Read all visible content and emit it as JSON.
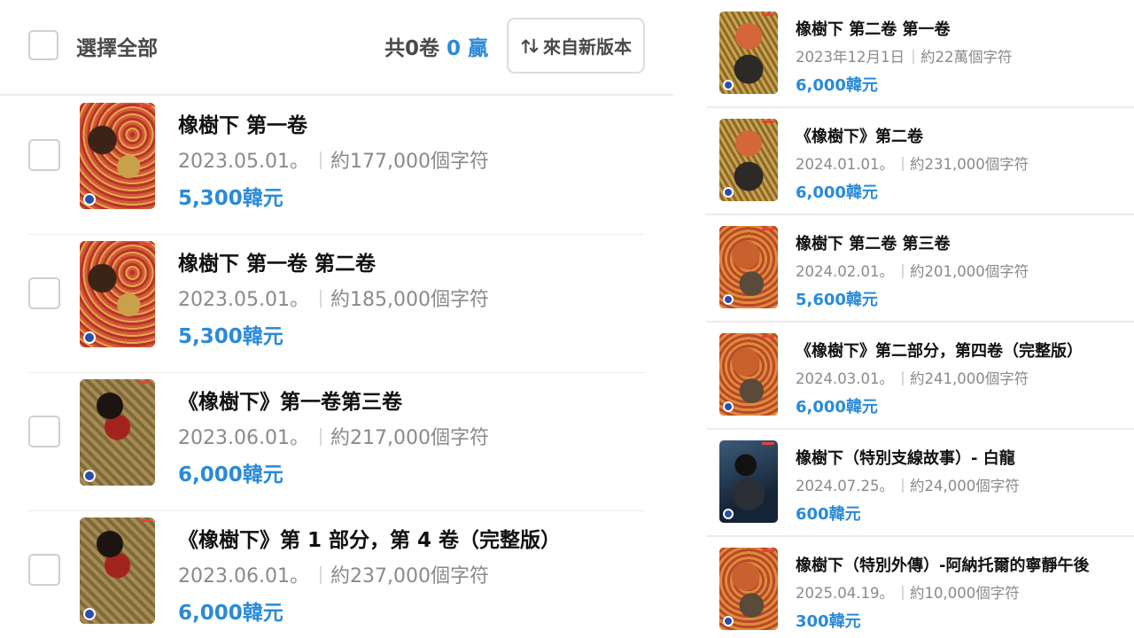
{
  "header": {
    "select_all_label": "選擇全部",
    "count_prefix": "共0卷",
    "count_num": "0",
    "count_suffix": "贏",
    "sort_label": "來自新版本",
    "sort_icon": "sort-arrows-icon"
  },
  "left_items": [
    {
      "title": "橡樹下 第一卷",
      "date": "2023.05.01。",
      "chars": "約177,000個字符",
      "price": "5,300韓元",
      "cover": "cv-a"
    },
    {
      "title": "橡樹下 第一卷 第二卷",
      "date": "2023.05.01。",
      "chars": "約185,000個字符",
      "price": "5,300韓元",
      "cover": "cv-a"
    },
    {
      "title": "《橡樹下》第一卷第三卷",
      "date": "2023.06.01。",
      "chars": "約217,000個字符",
      "price": "6,000韓元",
      "cover": "cv-b"
    },
    {
      "title": "《橡樹下》第 1 部分，第 4 卷（完整版）",
      "date": "2023.06.01。",
      "chars": "約237,000個字符",
      "price": "6,000韓元",
      "cover": "cv-b"
    }
  ],
  "right_items": [
    {
      "title": "橡樹下 第二卷 第一卷",
      "date": "2023年12月1日",
      "chars": "約22萬個字符",
      "price": "6,000韓元",
      "cover": "cv-c"
    },
    {
      "title": "《橡樹下》第二卷",
      "date": "2024.01.01。",
      "chars": "約231,000個字符",
      "price": "6,000韓元",
      "cover": "cv-c"
    },
    {
      "title": "橡樹下 第二卷 第三卷",
      "date": "2024.02.01。",
      "chars": "約201,000個字符",
      "price": "5,600韓元",
      "cover": "cv-d"
    },
    {
      "title": "《橡樹下》第二部分，第四卷（完整版）",
      "date": "2024.03.01。",
      "chars": "約241,000個字符",
      "price": "6,000韓元",
      "cover": "cv-d"
    },
    {
      "title": "橡樹下（特別支線故事）- 白龍",
      "date": "2024.07.25。",
      "chars": "約24,000個字符",
      "price": "600韓元",
      "cover": "cv-e"
    },
    {
      "title": "橡樹下（特別外傳）-阿納托爾的寧靜午後",
      "date": "2025.04.19。",
      "chars": "約10,000個字符",
      "price": "300韓元",
      "cover": "cv-d"
    }
  ],
  "colors": {
    "accent": "#2a8ad8",
    "text": "#111111",
    "muted": "#8a8a8a",
    "divider": "#ececec"
  }
}
